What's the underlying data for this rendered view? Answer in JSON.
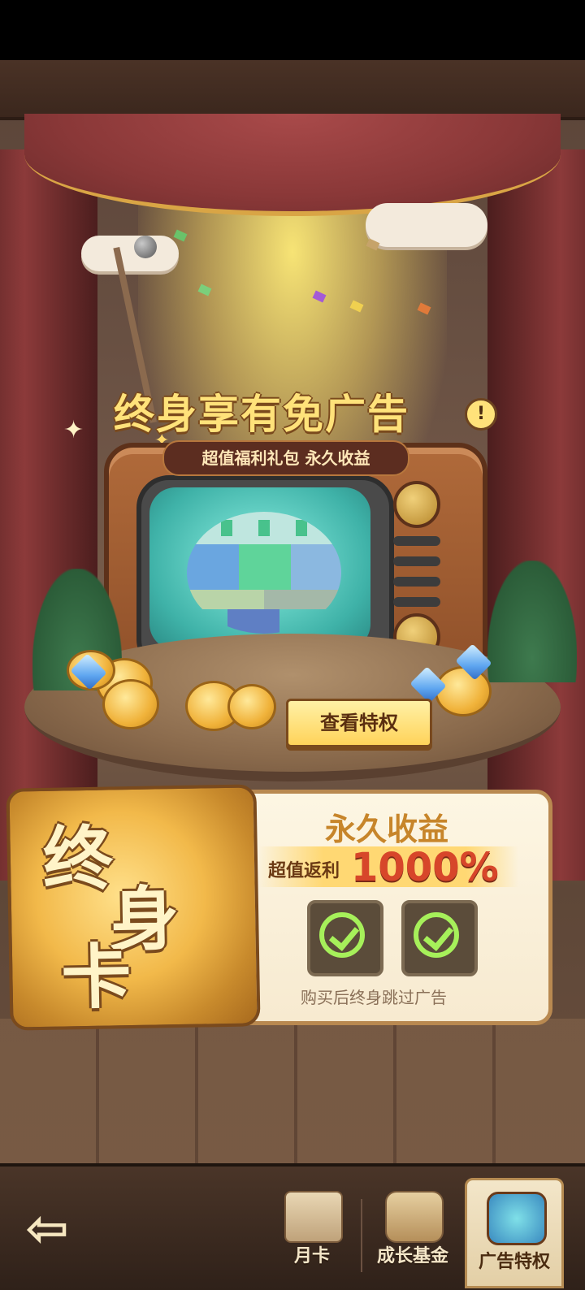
{
  "promo": {
    "headline": "终身享有免广告",
    "info_symbol": "!",
    "subtitle": "超值福利礼包  永久收益",
    "view_button": "查看特权"
  },
  "card": {
    "emblem_chars": [
      "终",
      "身",
      "卡"
    ],
    "benefit_title": "永久收益",
    "cashback_label": "超值返利",
    "cashback_value": "1000%",
    "footnote": "购买后终身跳过广告"
  },
  "nav": {
    "back_symbol": "⇦",
    "tabs": [
      {
        "label": "月卡",
        "icon": "monthly-card-icon",
        "active": false
      },
      {
        "label": "成长基金",
        "icon": "growth-fund-icon",
        "active": false
      },
      {
        "label": "广告特权",
        "icon": "ad-privilege-tv-icon",
        "active": true
      }
    ]
  },
  "colors": {
    "gold_text": "#ffe27a",
    "accent_red": "#d7462a",
    "check_green": "#a6f05a"
  }
}
